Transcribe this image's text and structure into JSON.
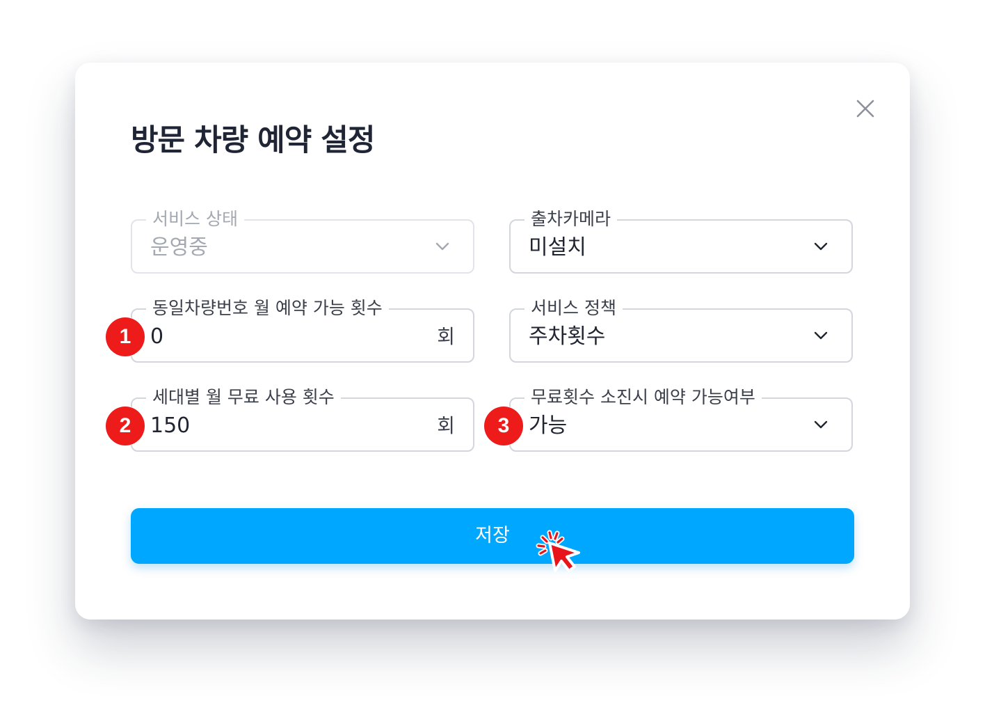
{
  "dialog": {
    "title": "방문 차량 예약 설정",
    "close_icon": "close-icon"
  },
  "fields": {
    "service_status": {
      "label": "서비스 상태",
      "value": "운영중",
      "disabled": true,
      "icon": "chevron-down-icon"
    },
    "exit_camera": {
      "label": "출차카메라",
      "value": "미설치",
      "icon": "chevron-down-icon"
    },
    "same_plate_monthly_limit": {
      "label": "동일차량번호 월 예약 가능 횟수",
      "value": "0",
      "unit": "회"
    },
    "service_policy": {
      "label": "서비스 정책",
      "value": "주차횟수",
      "icon": "chevron-down-icon"
    },
    "household_monthly_free": {
      "label": "세대별 월 무료 사용 횟수",
      "value": "150",
      "unit": "회"
    },
    "reserve_when_exhausted": {
      "label": "무료횟수 소진시 예약 가능여부",
      "value": "가능",
      "icon": "chevron-down-icon"
    }
  },
  "annotations": {
    "badge_1": "1",
    "badge_2": "2",
    "badge_3": "3",
    "badge_color": "#ee1b1b"
  },
  "save_button": {
    "label": "저장",
    "color": "#00a7ff"
  },
  "cursor_icon": "click-cursor-icon"
}
